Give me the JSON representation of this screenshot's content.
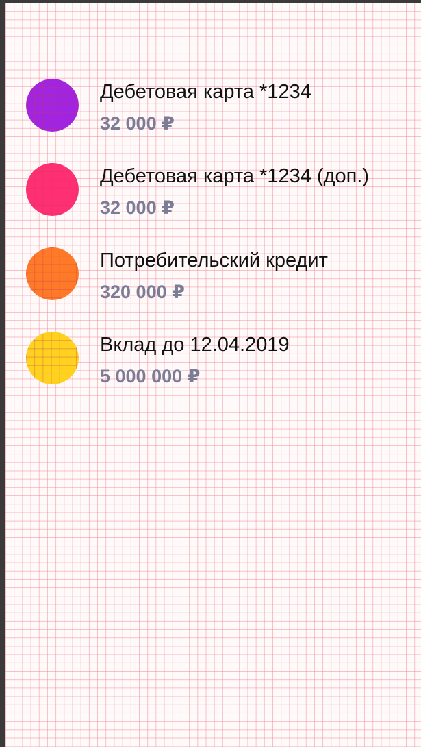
{
  "accounts": [
    {
      "name": "Дебетовая карта *1234",
      "balance": "32 000 ₽",
      "icon": "purple-circle-icon",
      "color": "#a024e0"
    },
    {
      "name": "Дебетовая карта *1234 (доп.)",
      "balance": "32 000 ₽",
      "icon": "pink-circle-icon",
      "color": "#ff2f74"
    },
    {
      "name": "Потребительский кредит",
      "balance": "320 000 ₽",
      "icon": "orange-circle-icon",
      "color": "#ff7a28"
    },
    {
      "name": "Вклад до 12.04.2019",
      "balance": "5 000 000 ₽",
      "icon": "yellow-circle-icon",
      "color": "#ffd21f"
    }
  ]
}
